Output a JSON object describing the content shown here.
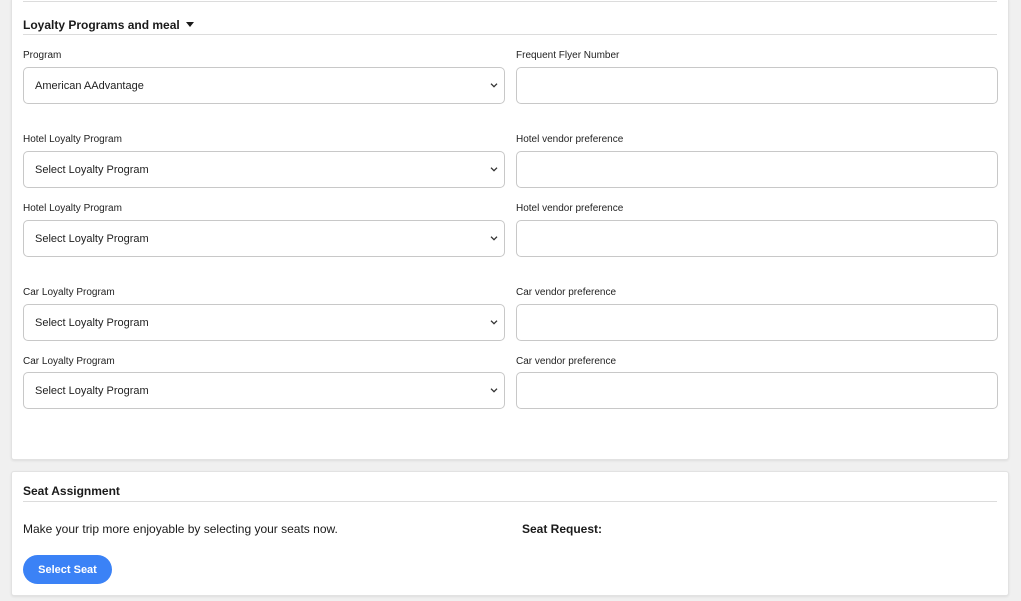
{
  "loyalty": {
    "title": "Loyalty Programs and meal",
    "fields": {
      "program_label": "Program",
      "program_value": "American AAdvantage",
      "ffn_label": "Frequent Flyer Number",
      "ffn_value": "",
      "hotel1_label": "Hotel Loyalty Program",
      "hotel1_value": "Select Loyalty Program",
      "hotelpref1_label": "Hotel vendor preference",
      "hotelpref1_value": "",
      "hotel2_label": "Hotel Loyalty Program",
      "hotel2_value": "Select Loyalty Program",
      "hotelpref2_label": "Hotel vendor preference",
      "hotelpref2_value": "",
      "car1_label": "Car Loyalty Program",
      "car1_value": "Select Loyalty Program",
      "carpref1_label": "Car vendor preference",
      "carpref1_value": "",
      "car2_label": "Car Loyalty Program",
      "car2_value": "Select Loyalty Program",
      "carpref2_label": "Car vendor preference",
      "carpref2_value": ""
    }
  },
  "seat": {
    "title": "Seat Assignment",
    "description": "Make your trip more enjoyable by selecting your seats now.",
    "request_label": "Seat Request:",
    "button_label": "Select Seat"
  },
  "colors": {
    "accent": "#3b82f6",
    "background": "#f0f0f0",
    "card": "#ffffff",
    "border": "#c8c8c8"
  },
  "icons": {
    "section_toggle": "caret-down-icon",
    "select_arrow": "chevron-down-icon"
  }
}
